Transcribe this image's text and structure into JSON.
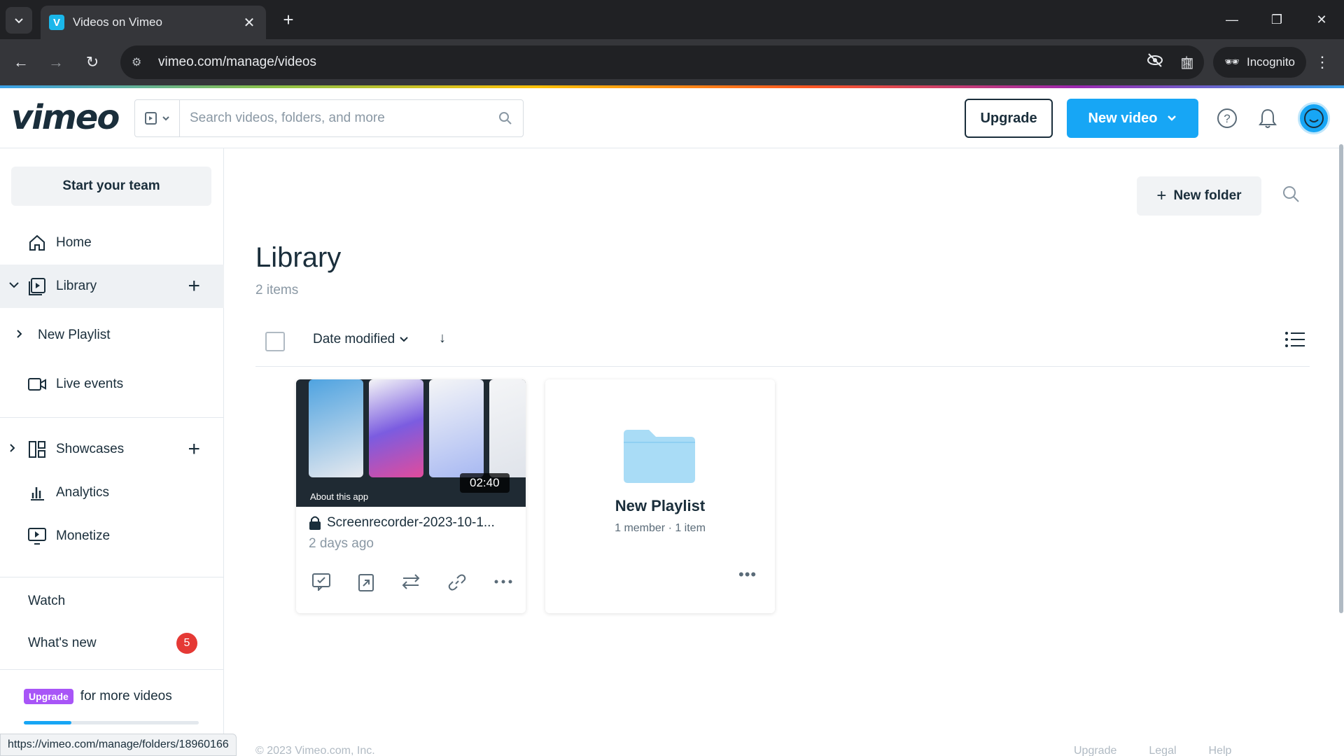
{
  "browser": {
    "tab_title": "Videos on Vimeo",
    "url": "vimeo.com/manage/videos",
    "incognito_label": "Incognito",
    "status_url": "https://vimeo.com/manage/folders/18960166"
  },
  "header": {
    "logo": "vimeo",
    "search_placeholder": "Search videos, folders, and more",
    "upgrade_label": "Upgrade",
    "new_video_label": "New video"
  },
  "sidebar": {
    "team_button": "Start your team",
    "items": [
      {
        "label": "Home",
        "icon": "home-icon"
      },
      {
        "label": "Library",
        "icon": "library-icon"
      },
      {
        "label": "New Playlist"
      },
      {
        "label": "Live events",
        "icon": "camera-icon"
      },
      {
        "label": "Showcases",
        "icon": "showcase-icon"
      },
      {
        "label": "Analytics",
        "icon": "analytics-icon"
      },
      {
        "label": "Monetize",
        "icon": "monetize-icon"
      }
    ],
    "watch_label": "Watch",
    "whats_new_label": "What's new",
    "whats_new_count": "5",
    "upgrade_pill": "Upgrade",
    "upgrade_text": "for more videos",
    "storage_used_fraction": 0.27
  },
  "main": {
    "new_folder_label": "New folder",
    "title": "Library",
    "item_count": "2 items",
    "sort_label": "Date modified",
    "video": {
      "title": "Screenrecorder-2023-10-1...",
      "modified": "2 days ago",
      "duration": "02:40",
      "thumb_caption": "About this app"
    },
    "playlist": {
      "title": "New Playlist",
      "meta": "1 member · 1 item"
    }
  },
  "footer": {
    "copyright": "© 2023 Vimeo.com, Inc.",
    "links": [
      "Upgrade",
      "Legal",
      "Help"
    ]
  },
  "colors": {
    "accent": "#17a6f5",
    "text": "#1a2e3b",
    "badge": "#e53935",
    "upgrade_pill": "#a855f7"
  }
}
